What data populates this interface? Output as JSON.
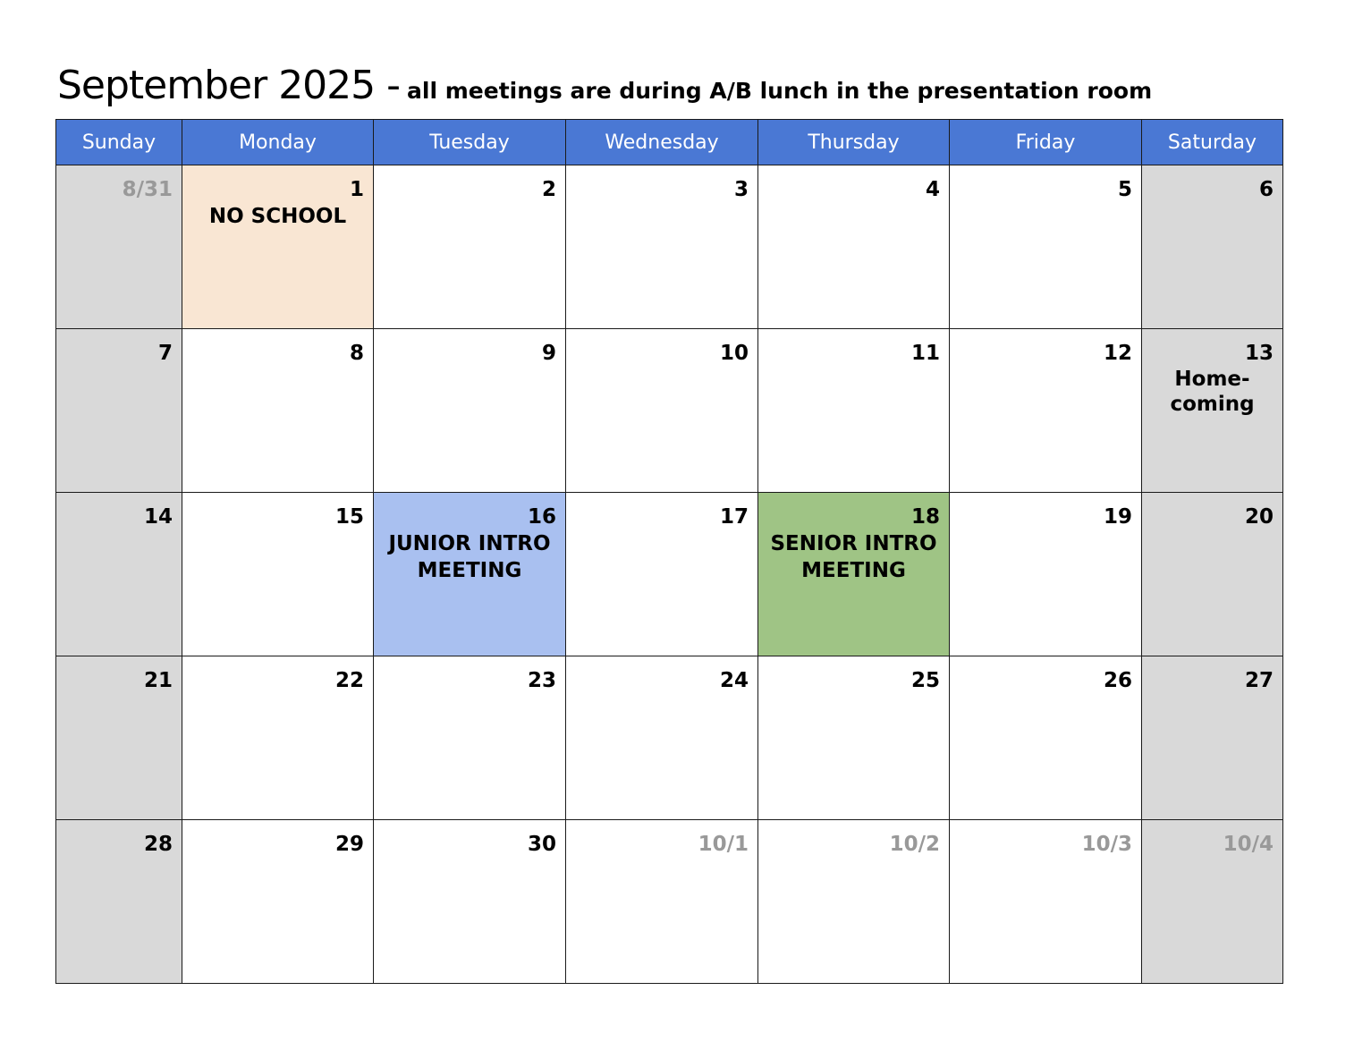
{
  "header": {
    "title": "September 2025 -",
    "subtitle": "all meetings are during A/B lunch in the presentation room"
  },
  "weekdays": [
    "Sunday",
    "Monday",
    "Tuesday",
    "Wednesday",
    "Thursday",
    "Friday",
    "Saturday"
  ],
  "colors": {
    "header_bg": "#4a78d4",
    "weekend_bg": "#d9d9d9",
    "no_school_bg": "#f9e6d3",
    "junior_bg": "#a9c0f0",
    "senior_bg": "#9fc485",
    "other_month_text": "#999999"
  },
  "weeks": [
    [
      {
        "day": "8/31",
        "other": true
      },
      {
        "day": "1",
        "event": "NO SCHOOL",
        "color": "#f9e6d3"
      },
      {
        "day": "2"
      },
      {
        "day": "3"
      },
      {
        "day": "4"
      },
      {
        "day": "5"
      },
      {
        "day": "6"
      }
    ],
    [
      {
        "day": "7"
      },
      {
        "day": "8"
      },
      {
        "day": "9"
      },
      {
        "day": "10"
      },
      {
        "day": "11"
      },
      {
        "day": "12"
      },
      {
        "day": "13",
        "event": "Home-\ncoming"
      }
    ],
    [
      {
        "day": "14"
      },
      {
        "day": "15"
      },
      {
        "day": "16",
        "event": "JUNIOR INTRO\nMEETING",
        "color": "#a9c0f0"
      },
      {
        "day": "17"
      },
      {
        "day": "18",
        "event": "SENIOR INTRO\nMEETING",
        "color": "#9fc485"
      },
      {
        "day": "19"
      },
      {
        "day": "20"
      }
    ],
    [
      {
        "day": "21"
      },
      {
        "day": "22"
      },
      {
        "day": "23"
      },
      {
        "day": "24"
      },
      {
        "day": "25"
      },
      {
        "day": "26"
      },
      {
        "day": "27"
      }
    ],
    [
      {
        "day": "28"
      },
      {
        "day": "29"
      },
      {
        "day": "30"
      },
      {
        "day": "10/1",
        "other": true
      },
      {
        "day": "10/2",
        "other": true
      },
      {
        "day": "10/3",
        "other": true
      },
      {
        "day": "10/4",
        "other": true
      }
    ]
  ]
}
